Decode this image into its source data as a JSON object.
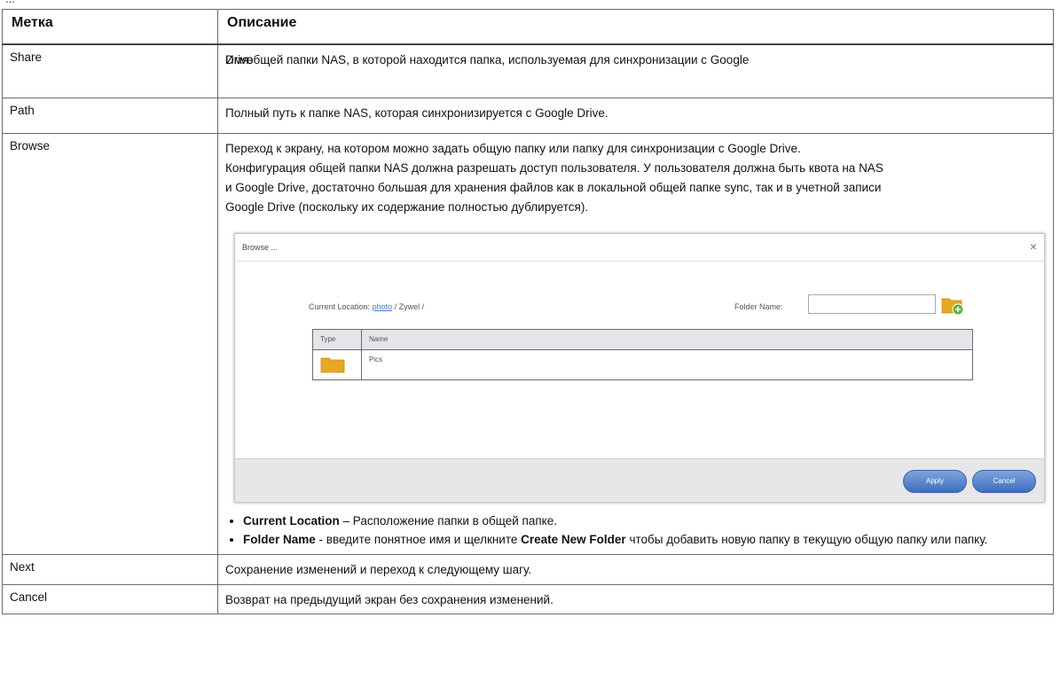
{
  "top_text": "...",
  "table": {
    "head": {
      "label": "Метка",
      "description": "Описание"
    },
    "rows": {
      "share": {
        "label": "Share",
        "desc_overlap_a": "Имя",
        "desc_overlap_b": "Drive",
        "desc": "общей папки NAS, в которой находится папка, используемая для синхронизации с Google"
      },
      "path": {
        "label": "Path",
        "desc": "Полный путь к папке NAS, которая синхронизируется с Google Drive."
      },
      "browse": {
        "label": "Browse",
        "desc_lines": [
          "Переход к экрану, на котором можно задать общую папку или папку для синхронизации с Google Drive.",
          "Конфигурация общей папки NAS должна разрешать доступ пользователя. У пользователя должна быть квота на NAS",
          "и Google Drive, достаточно большая для хранения файлов как в локальной общей папке sync, так и в учетной записи",
          "Google Drive (поскольку их содержание полностью дублируется)."
        ],
        "dialog": {
          "title": "Browse ...",
          "close": "×",
          "current_location_label": "Current Location:",
          "location_link": "photo",
          "location_rest": " / Zywel /",
          "folder_name_label": "Folder Name:",
          "folder_name_value": "",
          "columns": {
            "type": "Type",
            "name": "Name"
          },
          "rows": [
            {
              "name": "Pics"
            }
          ],
          "apply": "Apply",
          "cancel": "Cancel"
        },
        "bullets": [
          {
            "term": "Current Location",
            "text": " – Расположение папки в общей папке."
          },
          {
            "term": "Folder Name",
            "text_a": " - введите понятное имя и щелкните ",
            "term_b": "Create New Folder",
            "text_b": " чтобы добавить новую папку в текущую общую папку или папку."
          }
        ]
      },
      "next": {
        "label": "Next",
        "desc": "Сохранение изменений и переход к следующему шагу."
      },
      "cancel": {
        "label": "Cancel",
        "desc": "Возврат на предыдущий экран без сохранения изменений."
      }
    }
  },
  "colors": {
    "border": "#6b6b6b",
    "link": "#4a7bc4",
    "button": "#4f7ec8",
    "folder": "#e8a825"
  }
}
